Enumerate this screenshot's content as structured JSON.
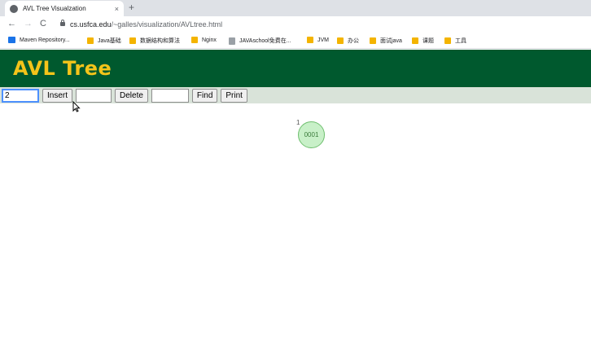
{
  "browser": {
    "tab_title": "AVL Tree Visualzation",
    "tab_close": "×",
    "new_tab": "+",
    "url_domain": "cs.usfca.edu",
    "url_path": "/~galles/visualization/AVLtree.html",
    "nav_back": "←",
    "nav_forward": "→",
    "nav_reload": "C"
  },
  "bookmarks": [
    {
      "label": "Maven Repository...",
      "icon": "apps-icon"
    },
    {
      "label": "Java基础",
      "icon": "folder-icon"
    },
    {
      "label": "数据结构和算法",
      "icon": "folder-icon"
    },
    {
      "label": "Nginx",
      "icon": "folder-icon"
    },
    {
      "label": "JAVAschool免费在...",
      "icon": "page-icon"
    },
    {
      "label": "JVM",
      "icon": "folder-icon"
    },
    {
      "label": "办公",
      "icon": "folder-icon"
    },
    {
      "label": "面试java",
      "icon": "folder-icon"
    },
    {
      "label": "课题",
      "icon": "folder-icon"
    },
    {
      "label": "工具",
      "icon": "folder-icon"
    }
  ],
  "page": {
    "title": "AVL Tree"
  },
  "controls": {
    "insert_value": "2",
    "insert_label": "Insert",
    "delete_value": "",
    "delete_label": "Delete",
    "find_value": "",
    "find_label": "Find",
    "print_label": "Print"
  },
  "tree": {
    "nodes": [
      {
        "label": "0001",
        "height": "1"
      }
    ]
  },
  "colors": {
    "header_bg": "#00592e",
    "title_color": "#f4c41a",
    "controls_bg": "#d9e3d9",
    "node_fill": "#c8f0c8",
    "node_border": "#6fbf6f"
  }
}
